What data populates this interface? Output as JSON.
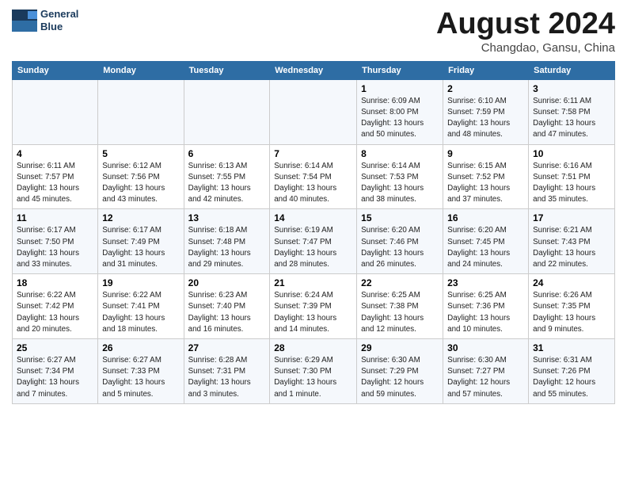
{
  "header": {
    "logo_line1": "General",
    "logo_line2": "Blue",
    "month": "August 2024",
    "location": "Changdao, Gansu, China"
  },
  "weekdays": [
    "Sunday",
    "Monday",
    "Tuesday",
    "Wednesday",
    "Thursday",
    "Friday",
    "Saturday"
  ],
  "weeks": [
    [
      {
        "day": "",
        "info": ""
      },
      {
        "day": "",
        "info": ""
      },
      {
        "day": "",
        "info": ""
      },
      {
        "day": "",
        "info": ""
      },
      {
        "day": "1",
        "info": "Sunrise: 6:09 AM\nSunset: 8:00 PM\nDaylight: 13 hours\nand 50 minutes."
      },
      {
        "day": "2",
        "info": "Sunrise: 6:10 AM\nSunset: 7:59 PM\nDaylight: 13 hours\nand 48 minutes."
      },
      {
        "day": "3",
        "info": "Sunrise: 6:11 AM\nSunset: 7:58 PM\nDaylight: 13 hours\nand 47 minutes."
      }
    ],
    [
      {
        "day": "4",
        "info": "Sunrise: 6:11 AM\nSunset: 7:57 PM\nDaylight: 13 hours\nand 45 minutes."
      },
      {
        "day": "5",
        "info": "Sunrise: 6:12 AM\nSunset: 7:56 PM\nDaylight: 13 hours\nand 43 minutes."
      },
      {
        "day": "6",
        "info": "Sunrise: 6:13 AM\nSunset: 7:55 PM\nDaylight: 13 hours\nand 42 minutes."
      },
      {
        "day": "7",
        "info": "Sunrise: 6:14 AM\nSunset: 7:54 PM\nDaylight: 13 hours\nand 40 minutes."
      },
      {
        "day": "8",
        "info": "Sunrise: 6:14 AM\nSunset: 7:53 PM\nDaylight: 13 hours\nand 38 minutes."
      },
      {
        "day": "9",
        "info": "Sunrise: 6:15 AM\nSunset: 7:52 PM\nDaylight: 13 hours\nand 37 minutes."
      },
      {
        "day": "10",
        "info": "Sunrise: 6:16 AM\nSunset: 7:51 PM\nDaylight: 13 hours\nand 35 minutes."
      }
    ],
    [
      {
        "day": "11",
        "info": "Sunrise: 6:17 AM\nSunset: 7:50 PM\nDaylight: 13 hours\nand 33 minutes."
      },
      {
        "day": "12",
        "info": "Sunrise: 6:17 AM\nSunset: 7:49 PM\nDaylight: 13 hours\nand 31 minutes."
      },
      {
        "day": "13",
        "info": "Sunrise: 6:18 AM\nSunset: 7:48 PM\nDaylight: 13 hours\nand 29 minutes."
      },
      {
        "day": "14",
        "info": "Sunrise: 6:19 AM\nSunset: 7:47 PM\nDaylight: 13 hours\nand 28 minutes."
      },
      {
        "day": "15",
        "info": "Sunrise: 6:20 AM\nSunset: 7:46 PM\nDaylight: 13 hours\nand 26 minutes."
      },
      {
        "day": "16",
        "info": "Sunrise: 6:20 AM\nSunset: 7:45 PM\nDaylight: 13 hours\nand 24 minutes."
      },
      {
        "day": "17",
        "info": "Sunrise: 6:21 AM\nSunset: 7:43 PM\nDaylight: 13 hours\nand 22 minutes."
      }
    ],
    [
      {
        "day": "18",
        "info": "Sunrise: 6:22 AM\nSunset: 7:42 PM\nDaylight: 13 hours\nand 20 minutes."
      },
      {
        "day": "19",
        "info": "Sunrise: 6:22 AM\nSunset: 7:41 PM\nDaylight: 13 hours\nand 18 minutes."
      },
      {
        "day": "20",
        "info": "Sunrise: 6:23 AM\nSunset: 7:40 PM\nDaylight: 13 hours\nand 16 minutes."
      },
      {
        "day": "21",
        "info": "Sunrise: 6:24 AM\nSunset: 7:39 PM\nDaylight: 13 hours\nand 14 minutes."
      },
      {
        "day": "22",
        "info": "Sunrise: 6:25 AM\nSunset: 7:38 PM\nDaylight: 13 hours\nand 12 minutes."
      },
      {
        "day": "23",
        "info": "Sunrise: 6:25 AM\nSunset: 7:36 PM\nDaylight: 13 hours\nand 10 minutes."
      },
      {
        "day": "24",
        "info": "Sunrise: 6:26 AM\nSunset: 7:35 PM\nDaylight: 13 hours\nand 9 minutes."
      }
    ],
    [
      {
        "day": "25",
        "info": "Sunrise: 6:27 AM\nSunset: 7:34 PM\nDaylight: 13 hours\nand 7 minutes."
      },
      {
        "day": "26",
        "info": "Sunrise: 6:27 AM\nSunset: 7:33 PM\nDaylight: 13 hours\nand 5 minutes."
      },
      {
        "day": "27",
        "info": "Sunrise: 6:28 AM\nSunset: 7:31 PM\nDaylight: 13 hours\nand 3 minutes."
      },
      {
        "day": "28",
        "info": "Sunrise: 6:29 AM\nSunset: 7:30 PM\nDaylight: 13 hours\nand 1 minute."
      },
      {
        "day": "29",
        "info": "Sunrise: 6:30 AM\nSunset: 7:29 PM\nDaylight: 12 hours\nand 59 minutes."
      },
      {
        "day": "30",
        "info": "Sunrise: 6:30 AM\nSunset: 7:27 PM\nDaylight: 12 hours\nand 57 minutes."
      },
      {
        "day": "31",
        "info": "Sunrise: 6:31 AM\nSunset: 7:26 PM\nDaylight: 12 hours\nand 55 minutes."
      }
    ]
  ]
}
